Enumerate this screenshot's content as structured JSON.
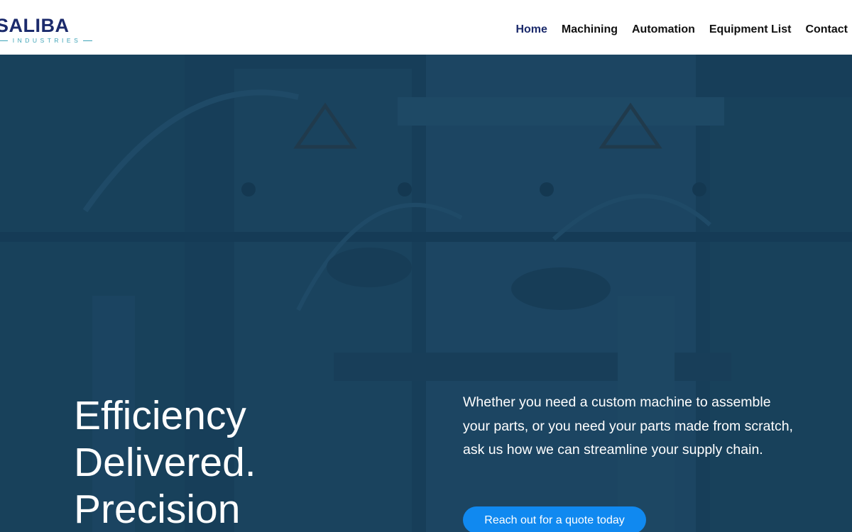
{
  "brand": {
    "name": "SALIBA",
    "tagline": "INDUSTRIES",
    "primary_color": "#1b2a6b",
    "accent_color": "#3ea3b7"
  },
  "nav": {
    "items": [
      {
        "label": "Home",
        "active": true
      },
      {
        "label": "Machining",
        "active": false
      },
      {
        "label": "Automation",
        "active": false
      },
      {
        "label": "Equipment List",
        "active": false
      },
      {
        "label": "Contact",
        "active": false
      }
    ]
  },
  "hero": {
    "title_lines": [
      "Efficiency",
      "Delivered.",
      "Precision"
    ],
    "description": "Whether you need a custom machine to assemble your parts, or you need your parts made from scratch, ask us how we can streamline your supply chain.",
    "cta_label": "Reach out for a quote today",
    "cta_color": "#1089f0",
    "overlay_color": "#163c57",
    "background_icon": "factory-machinery-photo"
  }
}
